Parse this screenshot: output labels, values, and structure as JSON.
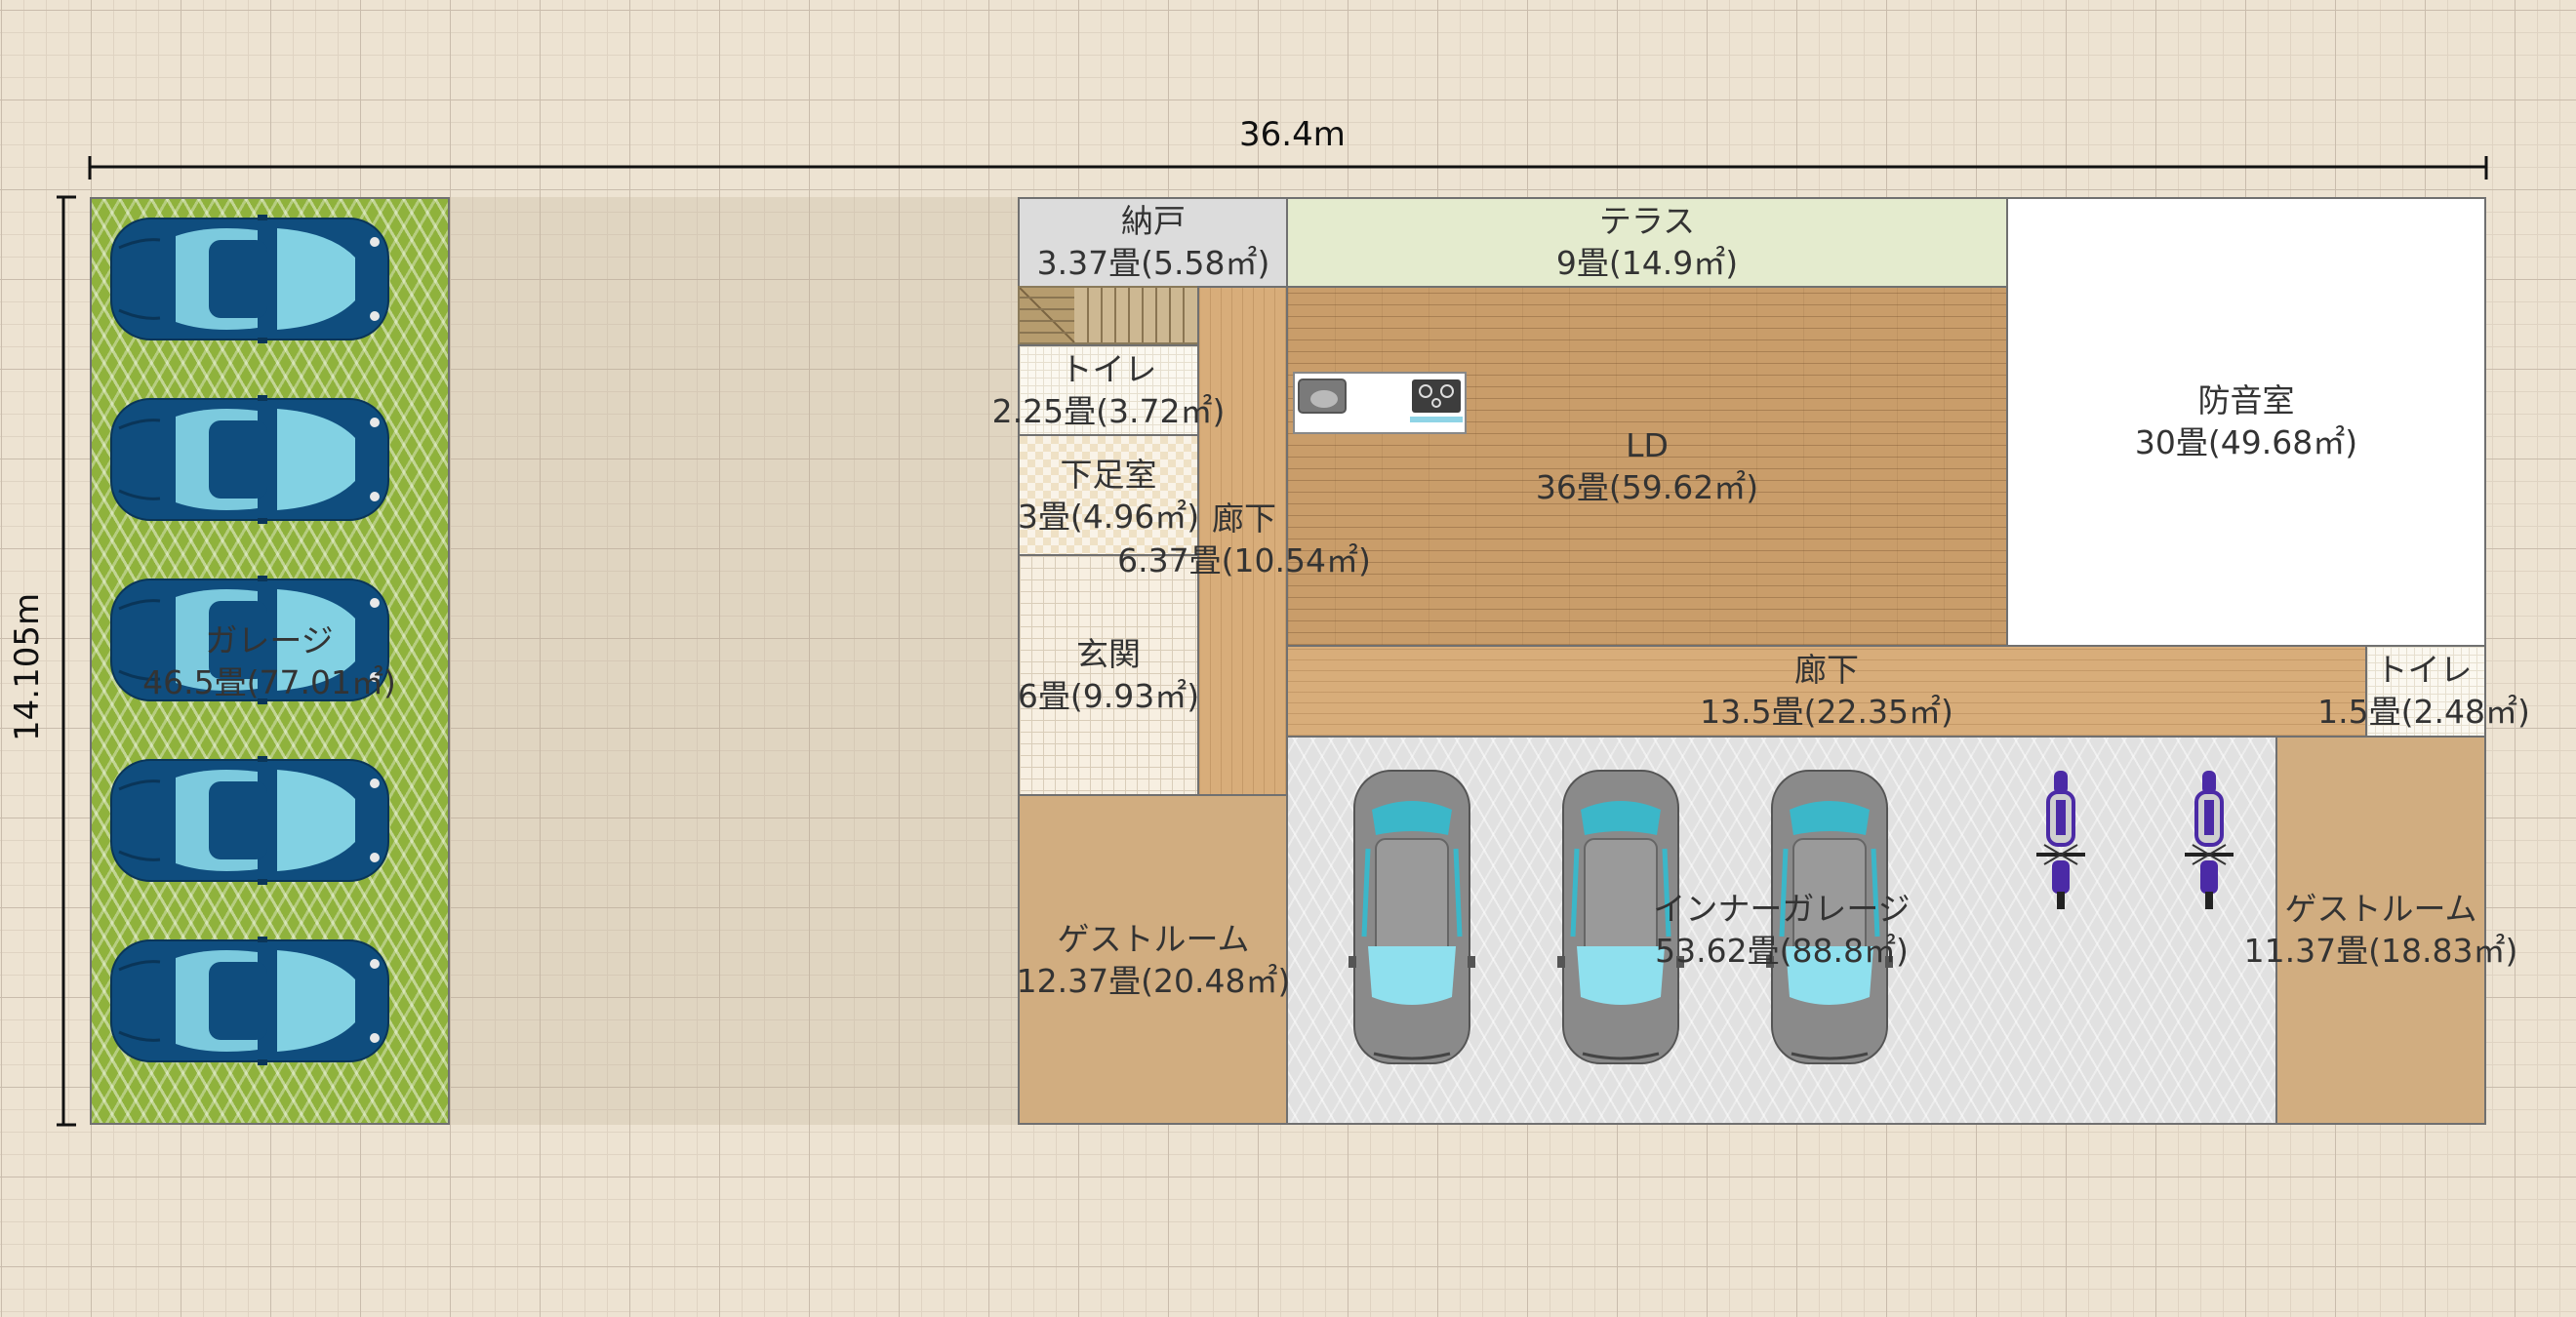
{
  "dimensions": {
    "width_label": "36.4m",
    "height_label": "14.105m"
  },
  "rooms": {
    "garage": {
      "name": "ガレージ",
      "area": "46.5畳(77.01㎡)"
    },
    "storage": {
      "name": "納戸",
      "area": "3.37畳(5.58㎡)"
    },
    "terrace": {
      "name": "テラス",
      "area": "9畳(14.9㎡)"
    },
    "soundproof": {
      "name": "防音室",
      "area": "30畳(49.68㎡)"
    },
    "toilet1": {
      "name": "トイレ",
      "area": "2.25畳(3.72㎡)"
    },
    "shoe_room": {
      "name": "下足室",
      "area": "3畳(4.96㎡)"
    },
    "hall1": {
      "name": "廊下",
      "area": "6.37畳(10.54㎡)"
    },
    "ld": {
      "name": "LD",
      "area": "36畳(59.62㎡)"
    },
    "entrance": {
      "name": "玄関",
      "area": "6畳(9.93㎡)"
    },
    "hall2": {
      "name": "廊下",
      "area": "13.5畳(22.35㎡)"
    },
    "toilet2": {
      "name": "トイレ",
      "area": "1.5畳(2.48㎡)"
    },
    "guest1": {
      "name": "ゲストルーム",
      "area": "12.37畳(20.48㎡)"
    },
    "inner_garage": {
      "name": "インナーガレージ",
      "area": "53.62畳(88.8㎡)"
    },
    "guest2": {
      "name": "ゲストルーム",
      "area": "11.37畳(18.83㎡)"
    }
  },
  "furniture": {
    "parked_cars": 5,
    "inner_cars": 3,
    "motorcycles": 2,
    "kitchen": "kitchen-counter",
    "stairs": "stairs"
  },
  "colors": {
    "car_blue": "#0f4d7e",
    "car_glass": "#8fe0ee",
    "car_gray": "#8a8a8a",
    "moto_purple": "#4b2aa6",
    "wall": "#707070"
  }
}
